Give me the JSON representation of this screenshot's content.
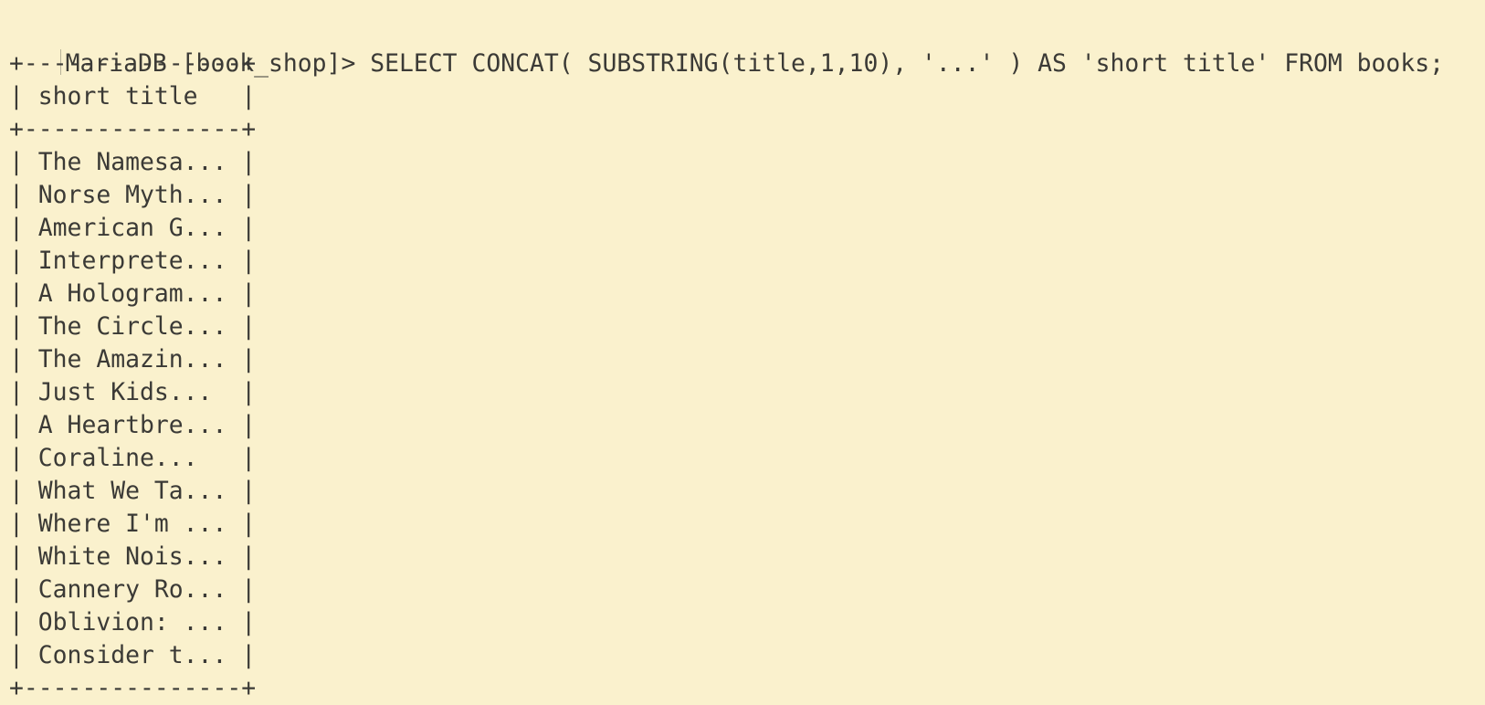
{
  "prompt": {
    "text": "MariaDB [book_shop]> ",
    "command": "SELECT CONCAT( SUBSTRING(title,1,10), '...' ) AS 'short title' FROM books;"
  },
  "result": {
    "border": "+---------------+",
    "header": "| short title   |",
    "rows": [
      "| The Namesa... |",
      "| Norse Myth... |",
      "| American G... |",
      "| Interprete... |",
      "| A Hologram... |",
      "| The Circle... |",
      "| The Amazin... |",
      "| Just Kids...  |",
      "| A Heartbre... |",
      "| Coraline...   |",
      "| What We Ta... |",
      "| Where I'm ... |",
      "| White Nois... |",
      "| Cannery Ro... |",
      "| Oblivion: ... |",
      "| Consider t... |"
    ]
  },
  "colors": {
    "background": "#faf1cd",
    "text": "#3b3a36"
  }
}
